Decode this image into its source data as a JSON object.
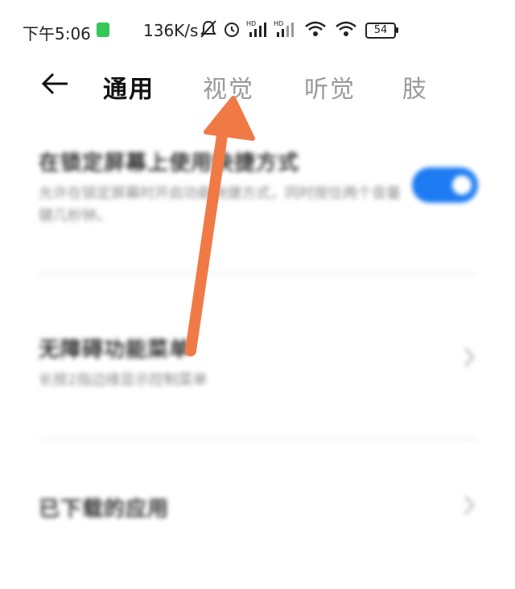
{
  "status_bar": {
    "time": "下午5:06",
    "net_speed": "136K/s",
    "battery": "54"
  },
  "nav": {
    "tabs": [
      {
        "label": "通用",
        "active": true
      },
      {
        "label": "视觉",
        "active": false
      },
      {
        "label": "听觉",
        "active": false
      },
      {
        "label": "肢",
        "active": false
      }
    ]
  },
  "settings": [
    {
      "title": "在锁定屏幕上使用快捷方式",
      "desc": "允许在锁定屏幕时开启功能快捷方式，同时按住两个音量键几秒钟。",
      "toggle": true
    },
    {
      "title": "无障碍功能菜单",
      "desc": "长按2指边缘显示控制菜单"
    },
    {
      "title": "已下载的应用",
      "desc": ""
    }
  ],
  "colors": {
    "accent": "#1e7bf2",
    "annotation_arrow": "#f07a46"
  }
}
